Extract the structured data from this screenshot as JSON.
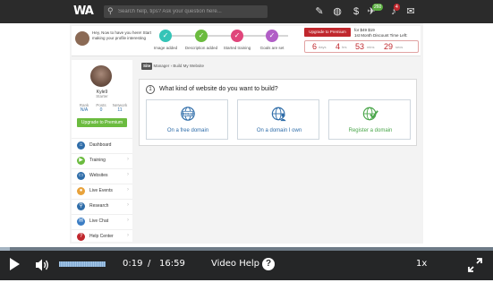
{
  "nav": {
    "logo": "WA",
    "search_placeholder": "Search help, tips? Ask your question here...",
    "notifications": [
      {
        "name": "pencil-icon",
        "badge": ""
      },
      {
        "name": "globe-icon",
        "badge": ""
      },
      {
        "name": "dollar-icon",
        "badge": ""
      },
      {
        "name": "airplane-icon",
        "badge": "260"
      },
      {
        "name": "bell-icon",
        "badge": "4"
      },
      {
        "name": "mail-icon",
        "badge": ""
      }
    ]
  },
  "banner": {
    "message": "Hey, Now to have you here! Start making your profile interesting",
    "steps": [
      {
        "label": "Image added",
        "color": "#35c4b7"
      },
      {
        "label": "Description added",
        "color": "#6bbb3f"
      },
      {
        "label": "Started training",
        "color": "#e0457b"
      },
      {
        "label": "Goals are set",
        "color": "#b15ec6"
      }
    ],
    "upgrade_label": "Upgrade to Premium",
    "price_line": "for $49 $19",
    "price_sub": "1st Month Discount Time Left:",
    "countdown": {
      "days": "6",
      "days_unit": "days",
      "hrs": "4",
      "hrs_unit": "hrs",
      "mins": "53",
      "mins_unit": "mins",
      "secs": "29",
      "secs_unit": "secs"
    }
  },
  "profile": {
    "name": "Kyle9",
    "rank_title": "Starter",
    "stats": [
      {
        "label": "Rank",
        "value": "N/A"
      },
      {
        "label": "Posts",
        "value": "0"
      },
      {
        "label": "Network",
        "value": "11"
      }
    ],
    "upgrade_label": "Upgrade to Premium"
  },
  "menu": [
    {
      "label": "Dashboard",
      "icon": "home-icon",
      "color": "#2f6da9",
      "glyph": "⌂"
    },
    {
      "label": "Training",
      "icon": "training-icon",
      "color": "#6bbb3f",
      "glyph": "▶"
    },
    {
      "label": "Websites",
      "icon": "websites-icon",
      "color": "#2f6da9",
      "glyph": "▭"
    },
    {
      "label": "Live Events",
      "icon": "live-events-icon",
      "color": "#e8a23b",
      "glyph": "●"
    },
    {
      "label": "Research",
      "icon": "research-icon",
      "color": "#2f6da9",
      "glyph": "⚲"
    },
    {
      "label": "Live Chat",
      "icon": "live-chat-icon",
      "color": "#3b7dc4",
      "glyph": "✉"
    },
    {
      "label": "Help Center",
      "icon": "help-center-icon",
      "color": "#c0272d",
      "glyph": "?"
    }
  ],
  "breadcrumb": {
    "badge": "Site",
    "items": [
      "Manager",
      "Build My Website"
    ]
  },
  "question": {
    "number": "1",
    "text": "What kind of website do you want to build?",
    "options": [
      {
        "label": "On a free domain",
        "icon": "free-globe-icon",
        "color": "#2f6da9"
      },
      {
        "label": "On a domain I own",
        "icon": "user-globe-icon",
        "color": "#2f6da9"
      },
      {
        "label": "Register a domain",
        "icon": "check-globe-icon",
        "color": "#4aa64a"
      }
    ]
  },
  "player": {
    "progress": 0.02,
    "volume_level": 1.0,
    "current_time": "0:19",
    "separator": "/",
    "duration": "16:59",
    "help_label": "Video Help",
    "help_glyph": "?",
    "speed": "1x"
  }
}
